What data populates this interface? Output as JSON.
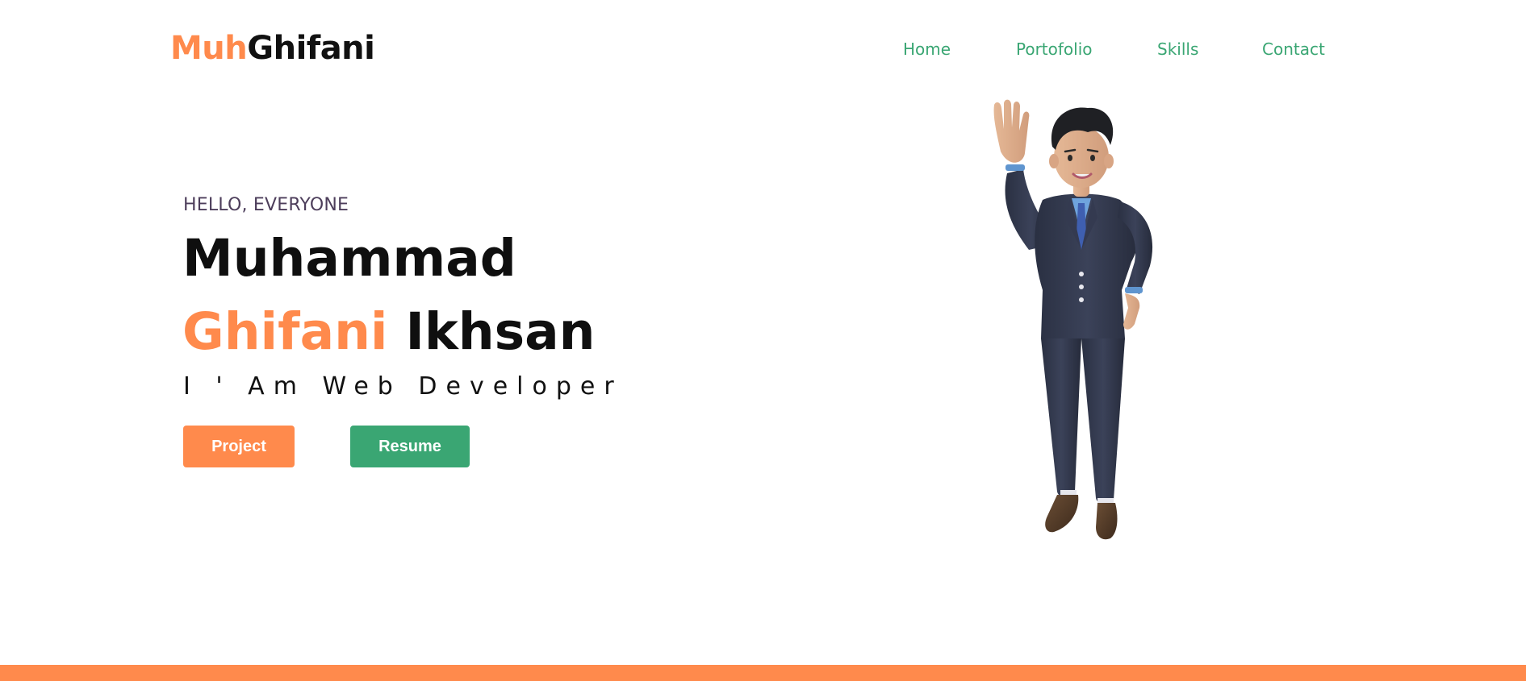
{
  "brand": {
    "logo_accent": "Muh",
    "logo_rest": "Ghifani",
    "accent_color": "#FF8A4C",
    "secondary_color": "#3aa673"
  },
  "nav": {
    "items": [
      {
        "label": "Home"
      },
      {
        "label": "Portofolio"
      },
      {
        "label": "Skills"
      },
      {
        "label": "Contact"
      }
    ]
  },
  "hero": {
    "greeting": "HELLO, EVERYONE",
    "name_line1": "Muhammad",
    "name_accent": "Ghifani",
    "name_rest": "Ikhsan",
    "role": "I ' Am Web Developer",
    "buttons": {
      "project": "Project",
      "resume": "Resume"
    },
    "illustration_icon": "waving-businessman-3d-avatar"
  }
}
